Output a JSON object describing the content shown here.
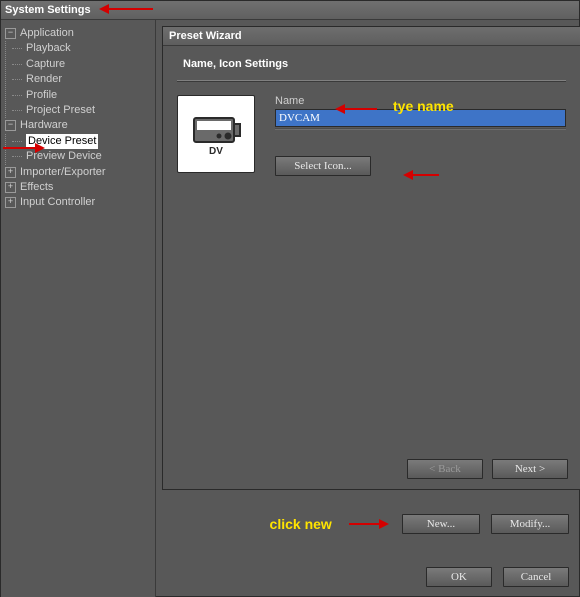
{
  "window": {
    "title": "System Settings"
  },
  "tree": {
    "application": {
      "label": "Application",
      "children": {
        "playback": "Playback",
        "capture": "Capture",
        "render": "Render",
        "profile": "Profile",
        "project_preset": "Project Preset"
      }
    },
    "hardware": {
      "label": "Hardware",
      "children": {
        "device_preset": "Device Preset",
        "preview_device": "Preview Device"
      }
    },
    "importer_exporter": {
      "label": "Importer/Exporter"
    },
    "effects": {
      "label": "Effects"
    },
    "input_controller": {
      "label": "Input Controller"
    }
  },
  "wizard": {
    "title": "Preset Wizard",
    "section": "Name, Icon Settings",
    "name_label": "Name",
    "name_value": "DVCAM",
    "select_icon": "Select Icon...",
    "back": "< Back",
    "next": "Next >",
    "icon_caption": "DV"
  },
  "device_buttons": {
    "new": "New...",
    "modify": "Modify..."
  },
  "dialog_buttons": {
    "ok": "OK",
    "cancel": "Cancel"
  },
  "annotations": {
    "type_name": "tye name",
    "click_new": "click new"
  }
}
